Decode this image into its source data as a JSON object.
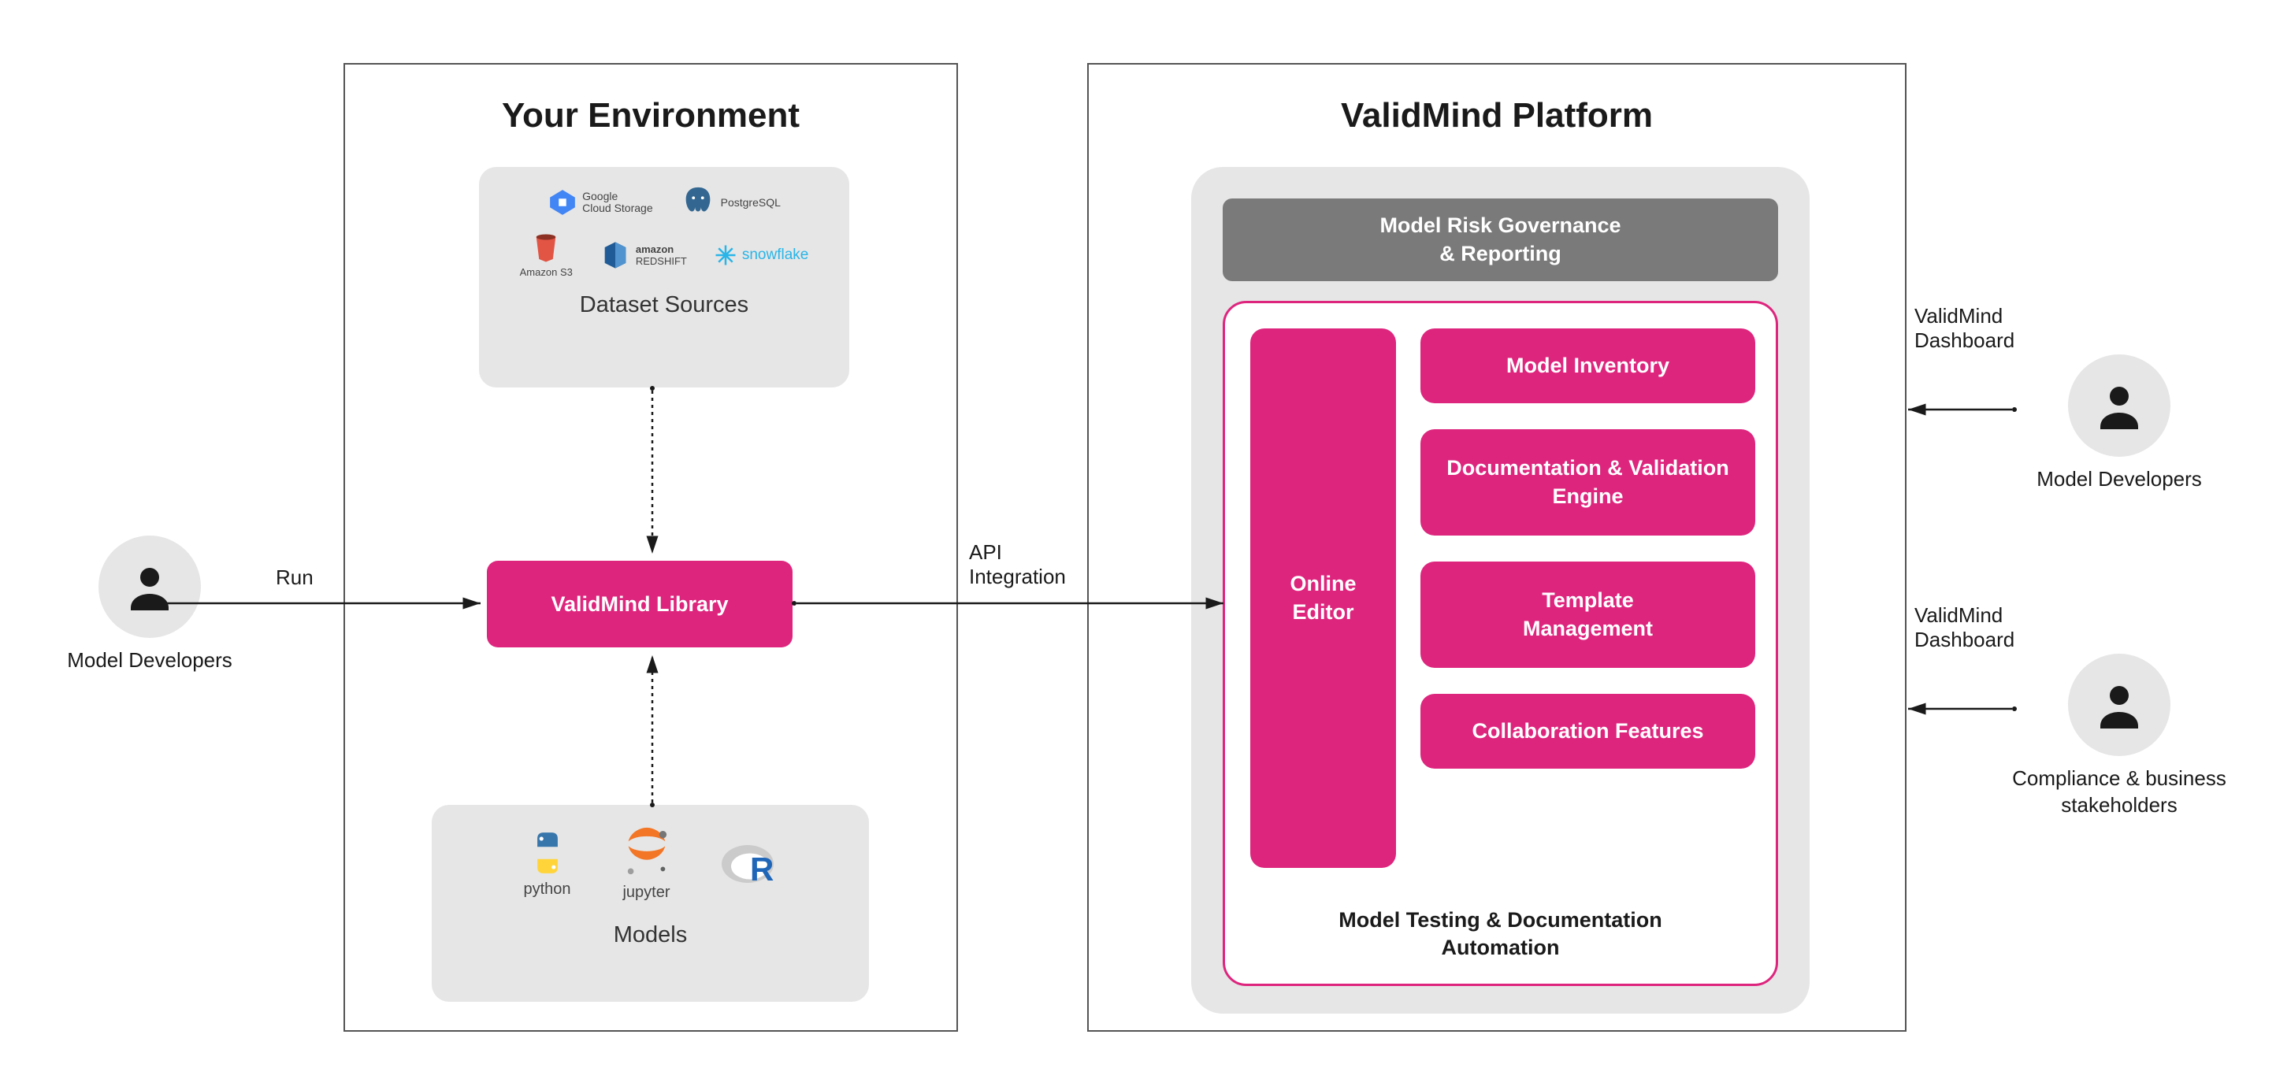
{
  "left_panel": {
    "title": "Your Environment",
    "datasets_title": "Dataset Sources",
    "models_title": "Models",
    "library_label": "ValidMind Library",
    "dataset_logos": [
      "Google Cloud Storage",
      "PostgreSQL",
      "Amazon S3",
      "amazon REDSHIFT",
      "snowflake"
    ],
    "model_logos": [
      "python",
      "jupyter",
      "R"
    ]
  },
  "right_panel": {
    "title": "ValidMind Platform",
    "governance_label": "Model Risk Governance\n& Reporting",
    "automation_title": "Model Testing & Documentation\nAutomation",
    "online_editor": "Online\nEditor",
    "features": [
      "Model Inventory",
      "Documentation & Validation\nEngine",
      "Template\nManagement",
      "Collaboration Features"
    ]
  },
  "personas": {
    "left": "Model Developers",
    "right_top": "Model Developers",
    "right_bottom": "Compliance & business\nstakeholders"
  },
  "arrows": {
    "run_label": "Run",
    "api_label": "API\nIntegration",
    "dashboard_label_top": "ValidMind\nDashboard",
    "dashboard_label_bottom": "ValidMind\nDashboard"
  }
}
